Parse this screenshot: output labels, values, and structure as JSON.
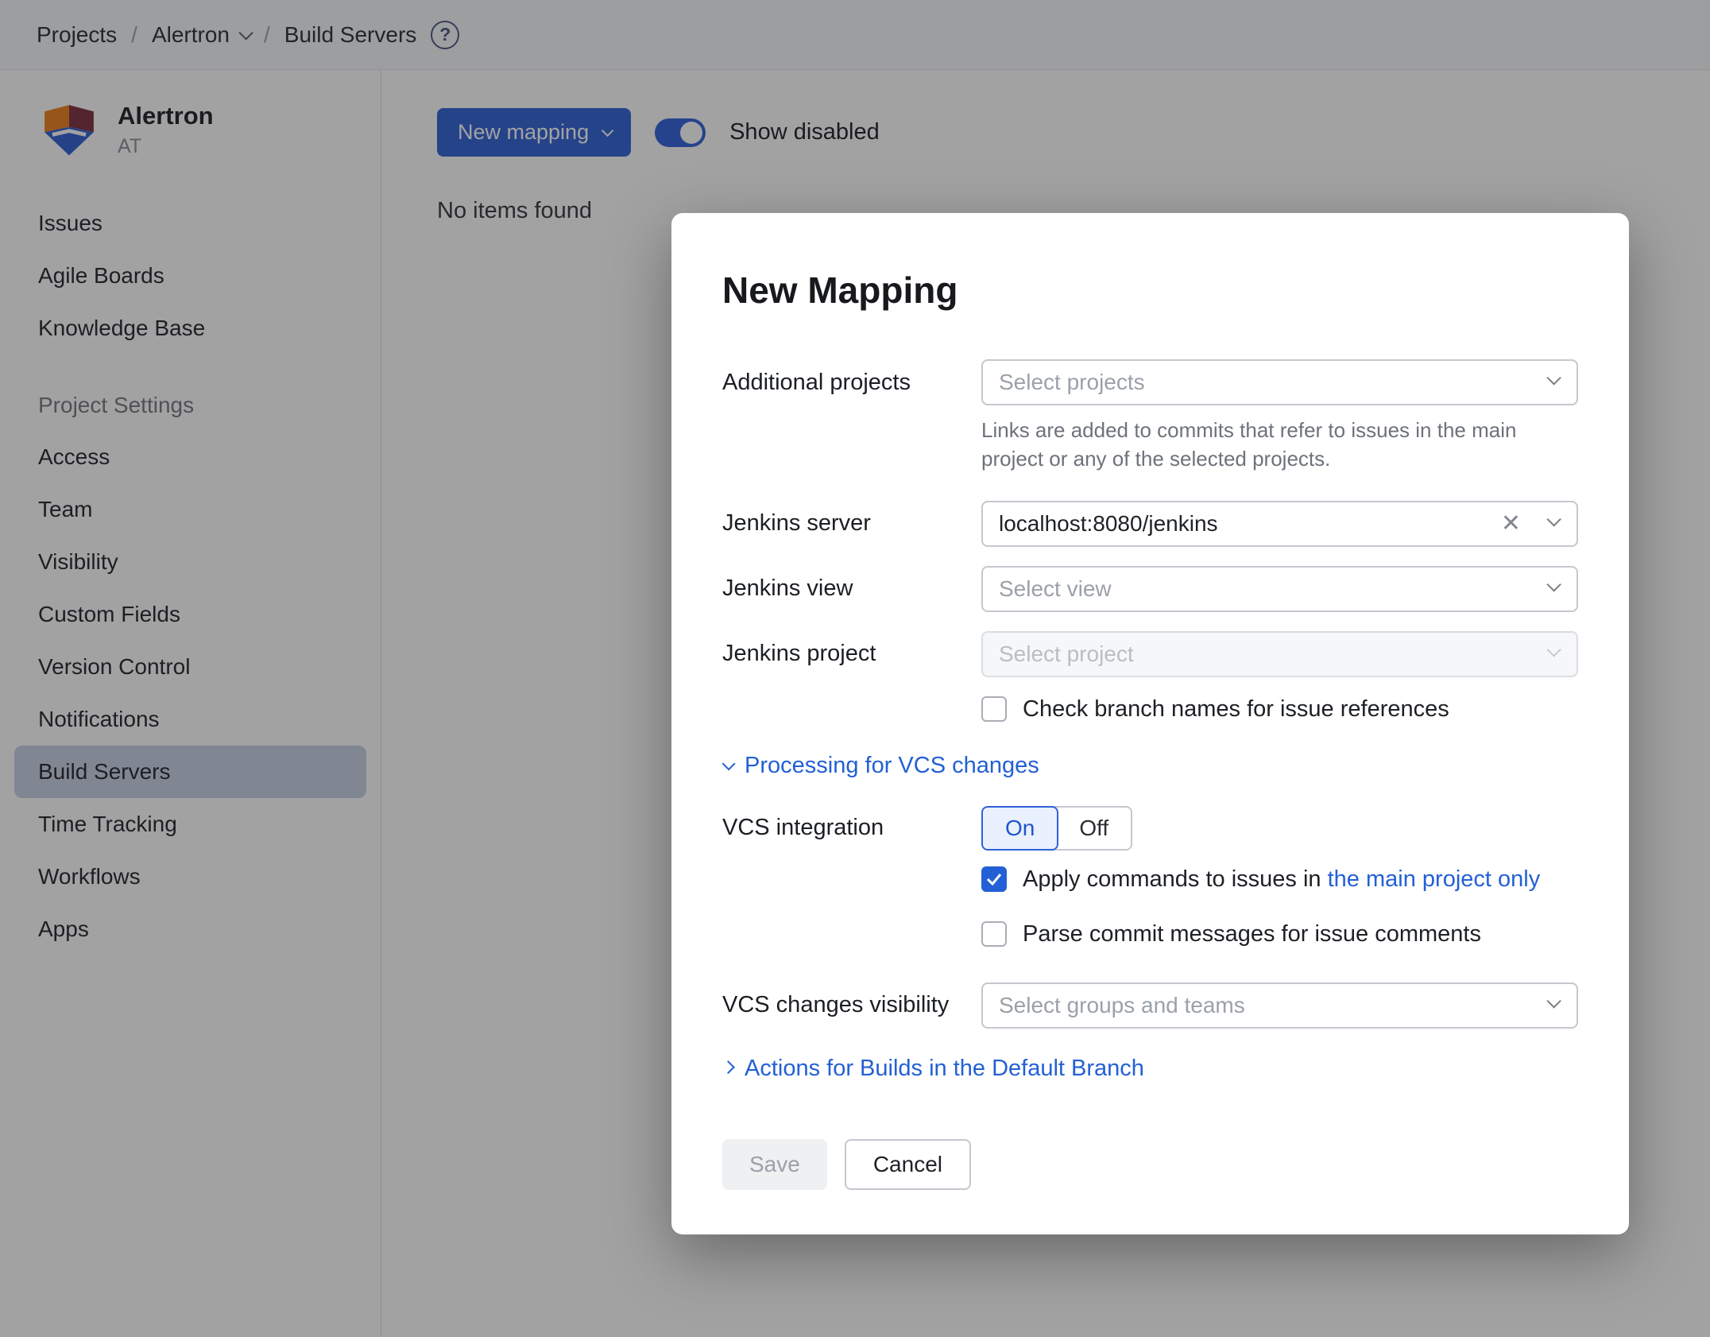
{
  "breadcrumb": {
    "items": [
      "Projects",
      "Alertron",
      "Build Servers"
    ]
  },
  "sidebar": {
    "project_name": "Alertron",
    "project_key": "AT",
    "nav_items": [
      "Issues",
      "Agile Boards",
      "Knowledge Base"
    ],
    "section_title": "Project Settings",
    "settings_items": [
      "Access",
      "Team",
      "Visibility",
      "Custom Fields",
      "Version Control",
      "Notifications",
      "Build Servers",
      "Time Tracking",
      "Workflows",
      "Apps"
    ],
    "selected_item": "Build Servers"
  },
  "content": {
    "new_mapping_button": "New mapping",
    "show_disabled_label": "Show disabled",
    "show_disabled_on": true,
    "empty_text": "No items found"
  },
  "modal": {
    "title": "New Mapping",
    "additional_projects": {
      "label": "Additional projects",
      "placeholder": "Select projects",
      "help": "Links are added to commits that refer to issues in the main project or any of the selected projects."
    },
    "jenkins_server": {
      "label": "Jenkins server",
      "value": "localhost:8080/jenkins"
    },
    "jenkins_view": {
      "label": "Jenkins view",
      "placeholder": "Select view"
    },
    "jenkins_project": {
      "label": "Jenkins project",
      "placeholder": "Select project",
      "disabled": true
    },
    "check_branch": {
      "label": "Check branch names for issue references",
      "checked": false
    },
    "vcs_section_title": "Processing for VCS changes",
    "vcs_integration": {
      "label": "VCS integration",
      "on_label": "On",
      "off_label": "Off",
      "selected": "On"
    },
    "apply_commands": {
      "label": "Apply commands to issues in",
      "link": "the main project only",
      "checked": true
    },
    "parse_commit": {
      "label": "Parse commit messages for issue comments",
      "checked": false
    },
    "vcs_visibility": {
      "label": "VCS changes visibility",
      "placeholder": "Select groups and teams"
    },
    "actions_section_title": "Actions for Builds in the Default Branch",
    "buttons": {
      "save": "Save",
      "cancel": "Cancel"
    }
  },
  "colors": {
    "accent_blue": "#3061d4",
    "link_blue": "#2360d6",
    "selected_nav_bg": "#c9d1e4",
    "toggle_on": "#2f62d9"
  }
}
